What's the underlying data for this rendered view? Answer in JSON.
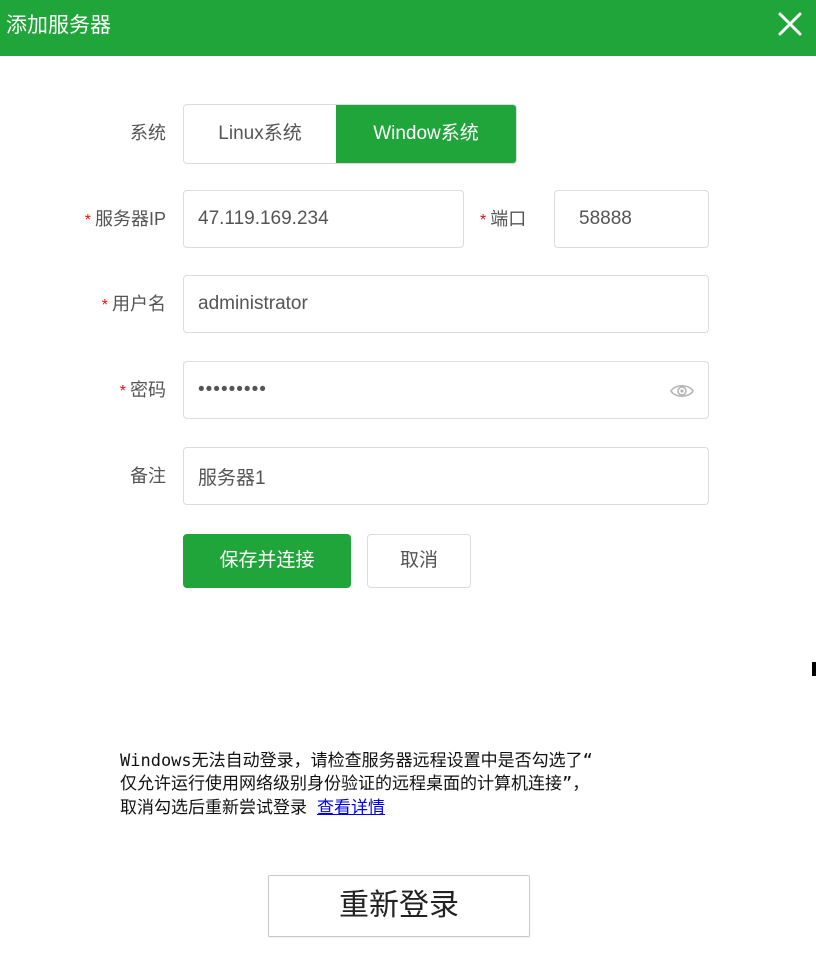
{
  "dialog": {
    "title": "添加服务器"
  },
  "form": {
    "system": {
      "label": "系统",
      "options": [
        "Linux系统",
        "Window系统"
      ],
      "selected": "Window系统"
    },
    "server_ip": {
      "label": "服务器IP",
      "required_mark": "*",
      "value": "47.119.169.234"
    },
    "port": {
      "label": "端口",
      "required_mark": "*",
      "value": "58888"
    },
    "username": {
      "label": "用户名",
      "required_mark": "*",
      "value": "administrator"
    },
    "password": {
      "label": "密码",
      "required_mark": "*",
      "value": "123456789"
    },
    "remark": {
      "label": "备注",
      "value": "服务器1"
    }
  },
  "actions": {
    "save_label": "保存并连接",
    "cancel_label": "取消"
  },
  "notice": {
    "lines": [
      "Windows无法自动登录，请检查服务器远程设置中是否勾选了“",
      "仅允许运行使用网络级别身份验证的远程桌面的计算机连接”，",
      "取消勾选后重新尝试登录"
    ],
    "link_label": "查看详情"
  },
  "relogin_label": "重新登录",
  "colors": {
    "accent": "#20a53a",
    "required": "#ef0808",
    "link": "#0000ee"
  },
  "icons": {
    "close": "close-icon",
    "password_toggle": "eye-icon"
  }
}
